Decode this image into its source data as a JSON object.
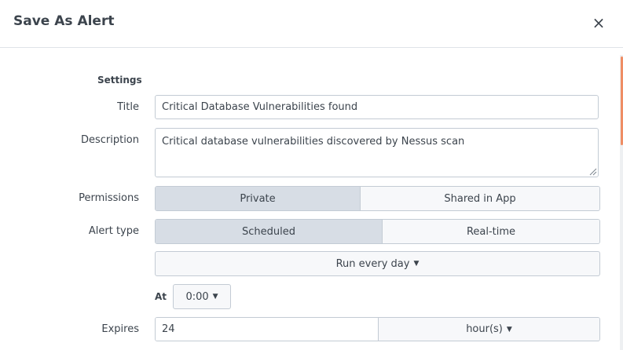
{
  "dialog": {
    "title": "Save As Alert",
    "close_symbol": "×"
  },
  "settings": {
    "section_label": "Settings",
    "title_label": "Title",
    "title_value": "Critical Database Vulnerabilities found",
    "description_label": "Description",
    "description_value": "Critical database vulnerabilities discovered by Nessus scan",
    "permissions_label": "Permissions",
    "permissions_options": [
      "Private",
      "Shared in App"
    ],
    "permissions_selected": "Private",
    "alert_type_label": "Alert type",
    "alert_type_options": [
      "Scheduled",
      "Real-time"
    ],
    "alert_type_selected": "Scheduled",
    "schedule_value": "Run every day",
    "at_label": "At",
    "at_value": "0:00",
    "expires_label": "Expires",
    "expires_value": "24",
    "expires_unit": "hour(s)"
  },
  "icons": {
    "close": "close-icon",
    "caret": "caret-down-icon",
    "resize": "resize-grip-icon"
  },
  "colors": {
    "accent_scroll": "#ef8d64",
    "selected_segment": "#d7dde5",
    "border": "#c3cbd4"
  }
}
